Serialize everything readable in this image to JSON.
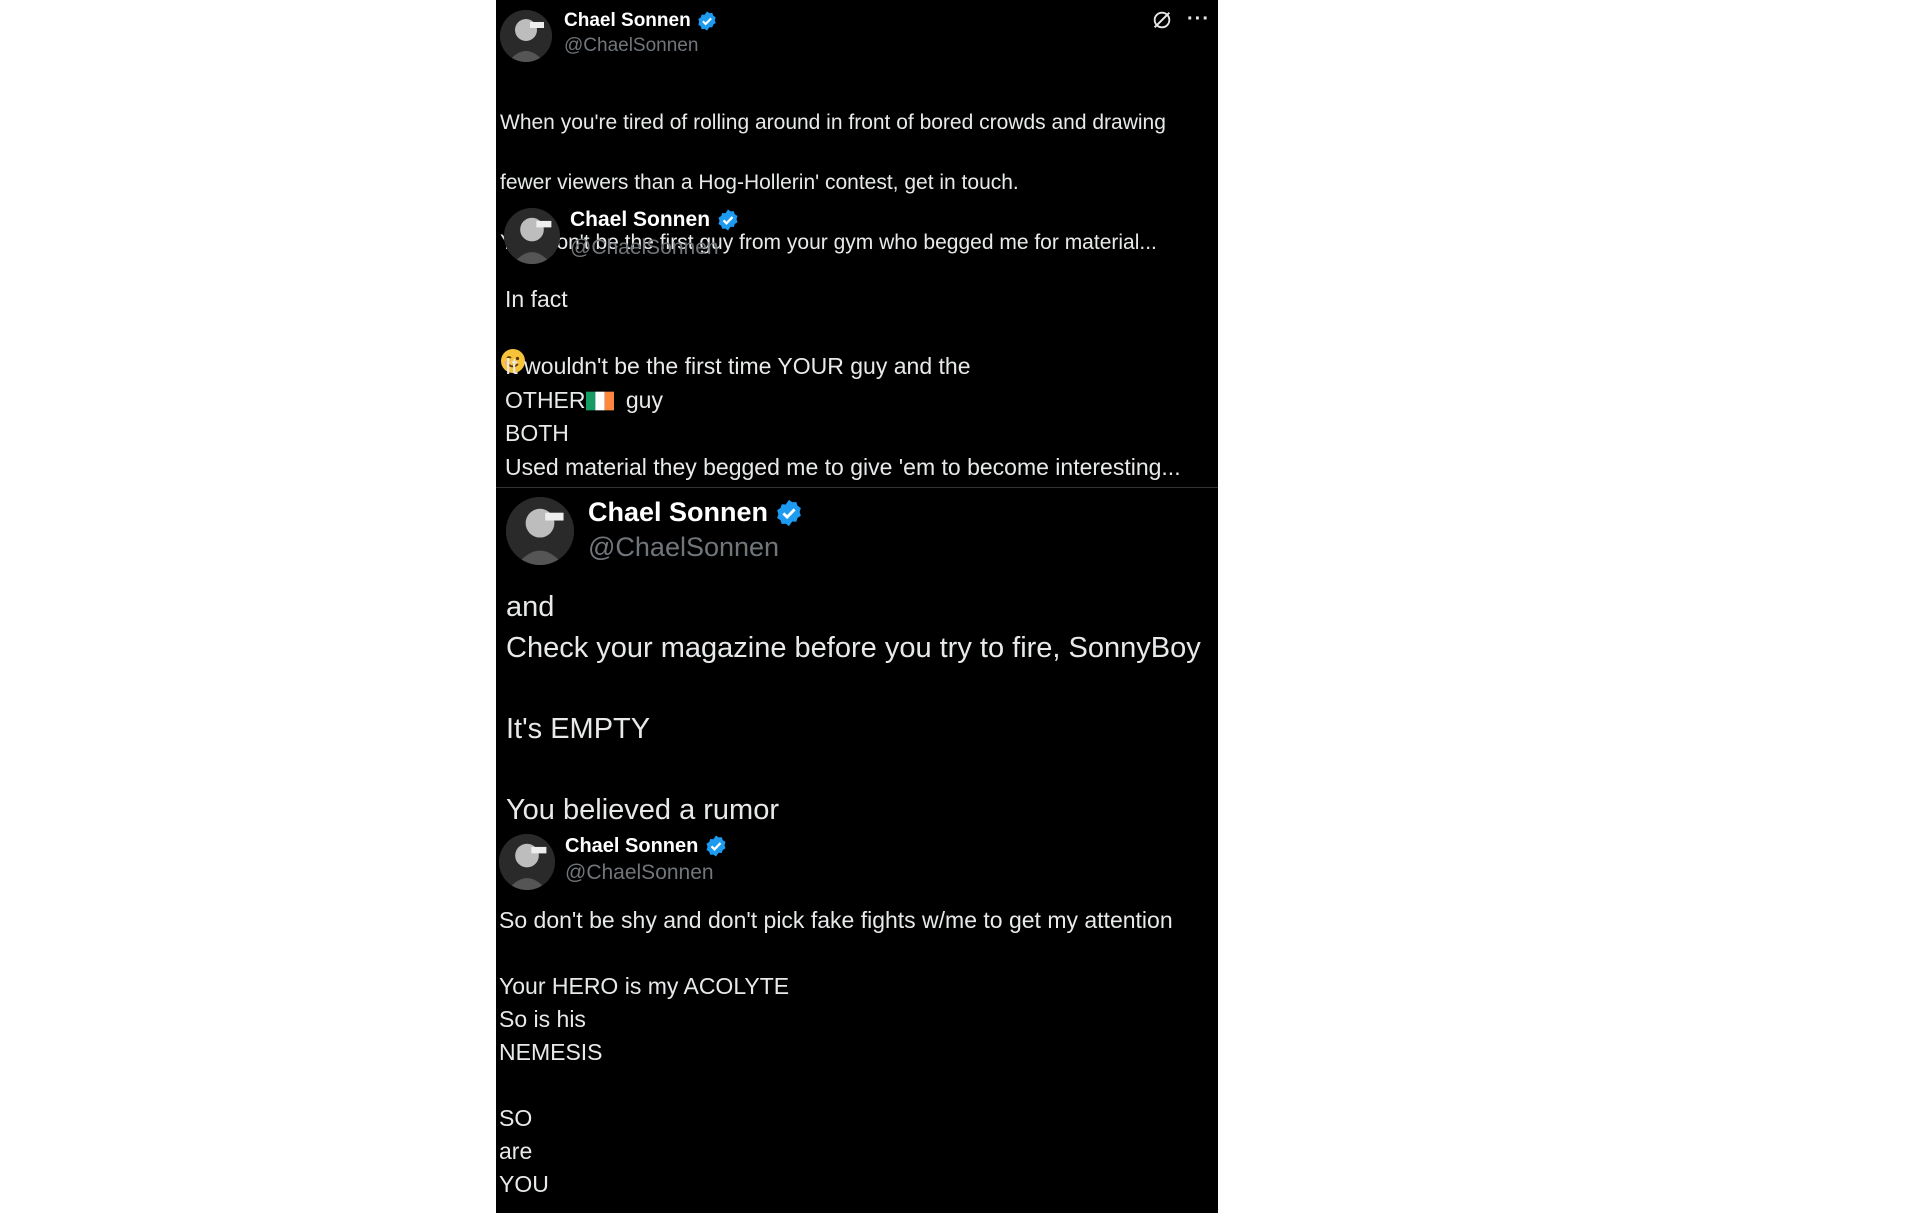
{
  "tweets": [
    {
      "name": "Chael Sonnen",
      "handle": "@ChaelSonnen",
      "lines": [
        "When you're tired of rolling around in front of bored crowds and drawing",
        "fewer viewers than a Hog-Hollerin' contest, get in touch.",
        "You won't be the first guy from your gym who begged me for material..."
      ],
      "emoji": "winking-face-emoji"
    },
    {
      "name": "Chael Sonnen",
      "handle": "@ChaelSonnen",
      "line1": "In fact",
      "line2": "It wouldn't be the first time YOUR guy and the",
      "line3a": "OTHER",
      "line3b": " guy",
      "line4": "BOTH",
      "line5": "Used material they begged me to give 'em to become interesting...",
      "flag": "ireland-flag-emoji"
    },
    {
      "name": "Chael Sonnen",
      "handle": "@ChaelSonnen",
      "lines": [
        "and",
        "Check your magazine before you try to fire, SonnyBoy",
        "It's EMPTY",
        "You believed a rumor"
      ]
    },
    {
      "name": "Chael Sonnen",
      "handle": "@ChaelSonnen",
      "lines": [
        "So don't be shy and don't pick fake fights w/me to get my attention",
        "Your HERO is my ACOLYTE",
        "So is his",
        "NEMESIS",
        "SO",
        "are",
        "YOU"
      ]
    }
  ],
  "actions": {
    "grok_icon": "grok-icon",
    "more_icon": "more-icon",
    "more_glyph": "···"
  },
  "colors": {
    "background": "#000000",
    "text": "#e7e9ea",
    "handle": "#71767b",
    "verified": "#1d9bf0"
  }
}
